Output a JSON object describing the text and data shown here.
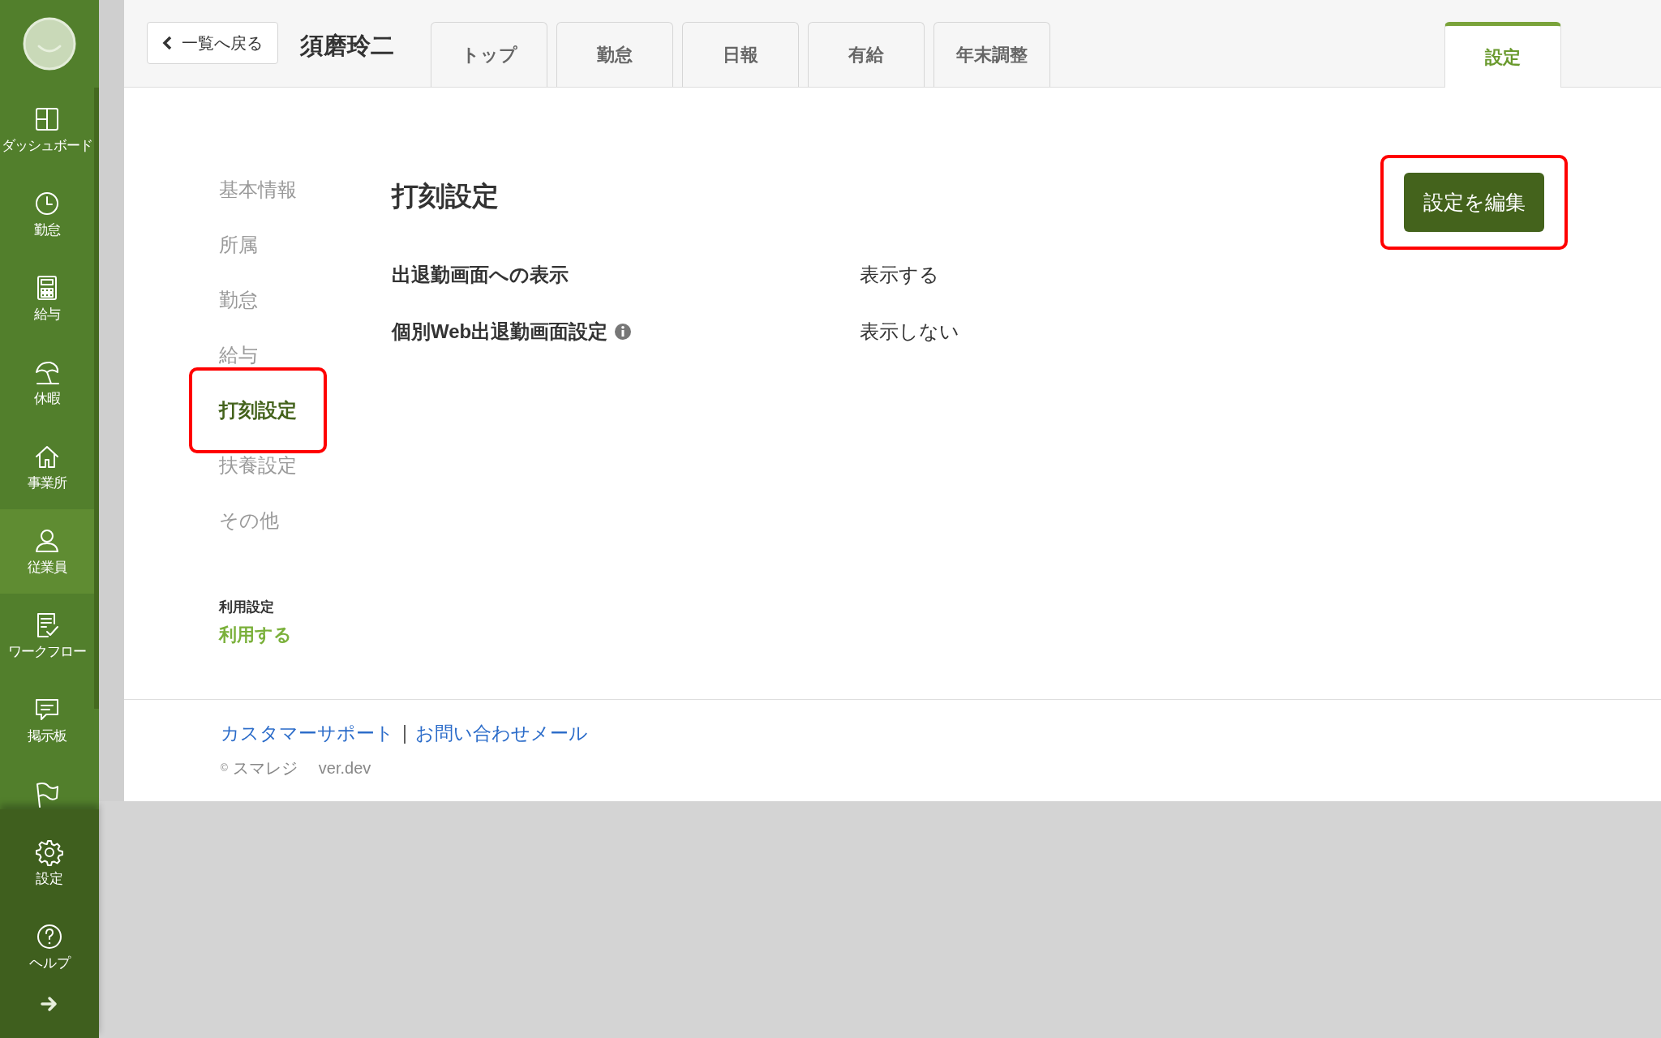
{
  "sidebar": {
    "items": [
      {
        "kind": "dashboard",
        "label": "ダッシュボード",
        "selected": false
      },
      {
        "kind": "clock",
        "label": "勤怠",
        "selected": false
      },
      {
        "kind": "calculator",
        "label": "給与",
        "selected": false
      },
      {
        "kind": "umbrella",
        "label": "休暇",
        "selected": false
      },
      {
        "kind": "house",
        "label": "事業所",
        "selected": false
      },
      {
        "kind": "person",
        "label": "従業員",
        "selected": true
      },
      {
        "kind": "checklist",
        "label": "ワークフロー",
        "selected": false
      },
      {
        "kind": "chat",
        "label": "掲示板",
        "selected": false
      },
      {
        "kind": "flag",
        "selected": false
      }
    ],
    "bottom_items": [
      {
        "kind": "gear",
        "label": "設定"
      },
      {
        "kind": "question",
        "label": "ヘルプ"
      }
    ]
  },
  "header": {
    "back_button": "一覧へ戻る",
    "employee_name": "須磨玲二",
    "tabs": [
      {
        "label": "トップ",
        "selected": false
      },
      {
        "label": "勤怠",
        "selected": false
      },
      {
        "label": "日報",
        "selected": false
      },
      {
        "label": "有給",
        "selected": false
      },
      {
        "label": "年末調整",
        "selected": false
      },
      {
        "label": "設定",
        "selected": true
      }
    ]
  },
  "settings_nav": {
    "items": [
      {
        "label": "基本情報",
        "selected": false,
        "highlighted": false
      },
      {
        "label": "所属",
        "selected": false,
        "highlighted": false
      },
      {
        "label": "勤怠",
        "selected": false,
        "highlighted": false
      },
      {
        "label": "給与",
        "selected": false,
        "highlighted": false
      },
      {
        "label": "打刻設定",
        "selected": true,
        "highlighted": true
      },
      {
        "label": "扶養設定",
        "selected": false,
        "highlighted": false
      },
      {
        "label": "その他",
        "selected": false,
        "highlighted": false
      }
    ],
    "usage_label": "利用設定",
    "usage_value": "利用する"
  },
  "content": {
    "title": "打刻設定",
    "edit_button": {
      "label": "設定を編集",
      "highlighted": true
    },
    "rows": [
      {
        "label": "出退勤画面への表示",
        "info": false,
        "value": "表示する"
      },
      {
        "label": "個別Web出退勤画面設定",
        "info": true,
        "value": "表示しない"
      }
    ]
  },
  "footer": {
    "links": [
      "カスタマーサポート",
      "お問い合わせメール"
    ],
    "separator": "|",
    "copyright": "©",
    "company": "スマレジ",
    "version": "ver.dev"
  }
}
